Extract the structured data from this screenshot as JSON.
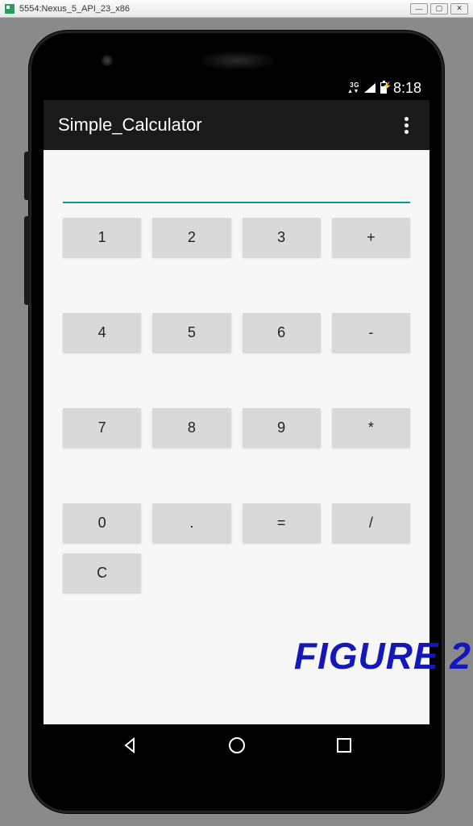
{
  "emulator": {
    "title": "5554:Nexus_5_API_23_x86"
  },
  "status_bar": {
    "network": "3G",
    "clock": "8:18"
  },
  "app_bar": {
    "title": "Simple_Calculator"
  },
  "calculator": {
    "display_value": "",
    "accent_color": "#0b9a8f",
    "buttons": {
      "r0": [
        "1",
        "2",
        "3",
        "+"
      ],
      "r1": [
        "4",
        "5",
        "6",
        "-"
      ],
      "r2": [
        "7",
        "8",
        "9",
        "*"
      ],
      "r3": [
        "0",
        ".",
        "=",
        "/"
      ],
      "r4": [
        "C"
      ]
    }
  },
  "figure_label": "FIGURE 2"
}
